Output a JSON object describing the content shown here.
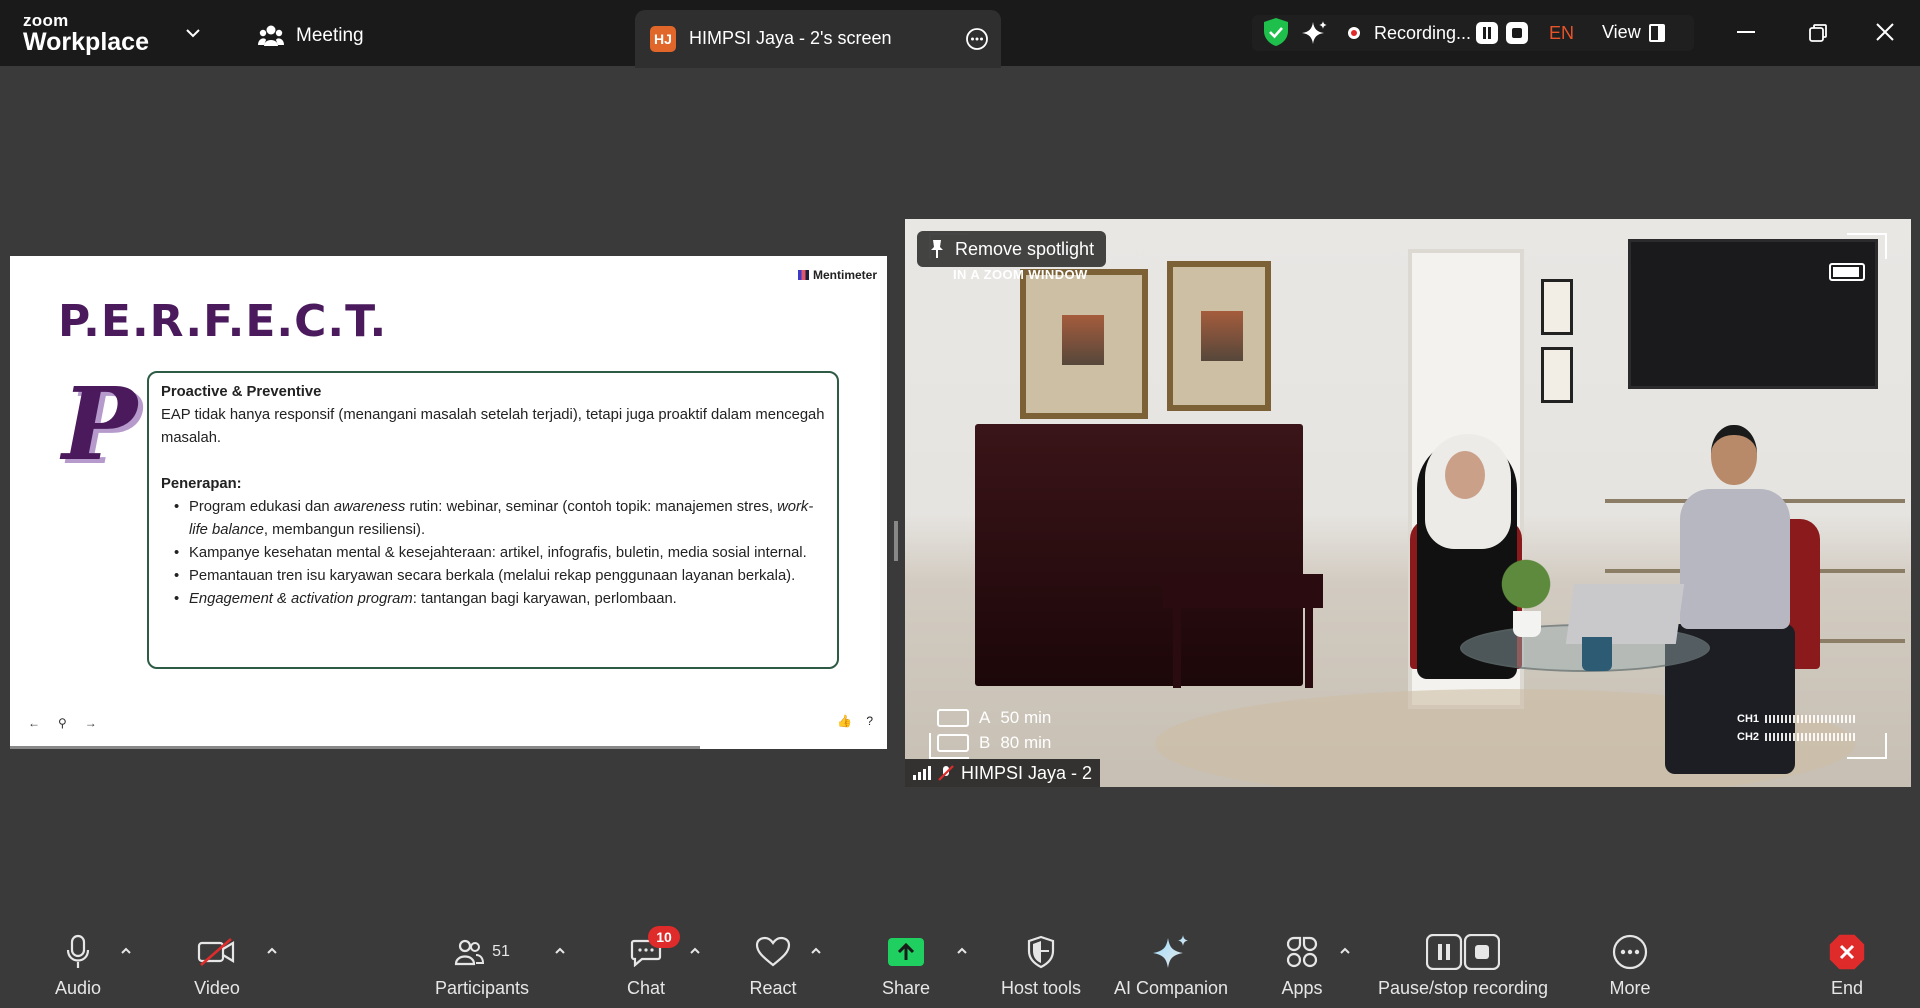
{
  "app": {
    "brand_small": "zoom",
    "brand_big": "Workplace",
    "meeting_label": "Meeting",
    "colors": {
      "recording": "#e02b2b",
      "lang": "#e8542a",
      "share": "#1fcf5f",
      "end": "#e02b2b",
      "security_ok": "#1fbf4b"
    }
  },
  "screen_tab": {
    "avatar_initials": "HJ",
    "title": "HIMPSI Jaya - 2's screen"
  },
  "status": {
    "recording_label": "Recording...",
    "language": "EN",
    "view_label": "View"
  },
  "slide": {
    "brand": "Mentimeter",
    "title": "P.E.R.F.E.C.T.",
    "big_letter": "P",
    "heading": "Proactive & Preventive",
    "paragraph": "EAP tidak hanya responsif (menangani masalah setelah terjadi), tetapi juga proaktif dalam mencegah masalah.",
    "subheading": "Penerapan:",
    "bullets": [
      {
        "pre": "Program edukasi dan ",
        "em": "awareness",
        "post": " rutin: webinar, seminar (contoh topik: manajemen stres, ",
        "em2": "work-life balance",
        "post2": ", membangun resiliensi)."
      },
      {
        "text": "Kampanye kesehatan mental & kesejahteraan: artikel, infografis, buletin, media sosial internal."
      },
      {
        "text": "Pemantauan tren isu karyawan secara berkala (melalui rekap penggunaan layanan berkala)."
      },
      {
        "em": "Engagement & activation program",
        "post": ": tantangan bagi karyawan, perlombaan."
      }
    ],
    "nav": {
      "prev": "←",
      "pin": "⚲",
      "next": "→"
    },
    "react": {
      "like": "👍",
      "qa": "?"
    }
  },
  "video": {
    "spotlight_label": "Remove spotlight",
    "overlay_tag": "IN A ZOOM WINDOW",
    "mic_a": {
      "channel": "A",
      "time": "50 min"
    },
    "mic_b": {
      "channel": "B",
      "time": "80 min"
    },
    "ch1": "CH1",
    "ch2": "CH2",
    "participant_name": "HIMPSI Jaya - 2"
  },
  "toolbar": {
    "audio": "Audio",
    "video": "Video",
    "participants": "Participants",
    "participants_count": "51",
    "chat": "Chat",
    "chat_badge": "10",
    "react": "React",
    "share": "Share",
    "host_tools": "Host tools",
    "ai_companion": "AI Companion",
    "apps": "Apps",
    "pause_stop": "Pause/stop recording",
    "more": "More",
    "end": "End"
  }
}
